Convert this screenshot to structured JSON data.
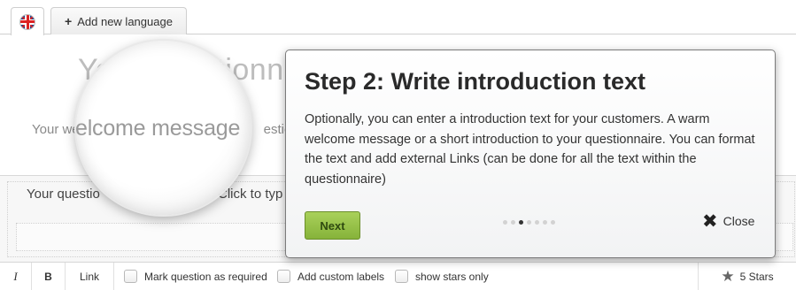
{
  "tabs": {
    "add_language_label": "Add new language",
    "add_icon": "plus-icon",
    "flag_icon": "uk-flag-icon"
  },
  "questionnaire": {
    "title": "Your questionn",
    "welcome_prefix": "Your we",
    "welcome_suffix": "estio",
    "question_prefix": "Your questio",
    "question_hint": "Click to typ"
  },
  "magnifier": {
    "text_a": "elcome ",
    "text_b": "message"
  },
  "toolbar": {
    "italic_label": "I",
    "bold_label": "B",
    "link_label": "Link",
    "required_label": "Mark question as required",
    "custom_labels_label": "Add custom labels",
    "stars_only_label": "show stars only",
    "stars_button_label": "5 Stars",
    "star_icon": "star-icon"
  },
  "tour": {
    "title": "Step 2: Write introduction text",
    "body": "Optionally, you can enter a introduction text for your customers. A warm welcome message or a short introduction to your questionnaire. You can format the text and add external Links (can be done for all the text within the questionnaire)",
    "next_label": "Next",
    "close_label": "Close",
    "close_icon": "close-icon",
    "steps_total": 7,
    "current_step": 2,
    "colors": {
      "next_button": "#95c247",
      "border": "#7b7b7b"
    }
  }
}
